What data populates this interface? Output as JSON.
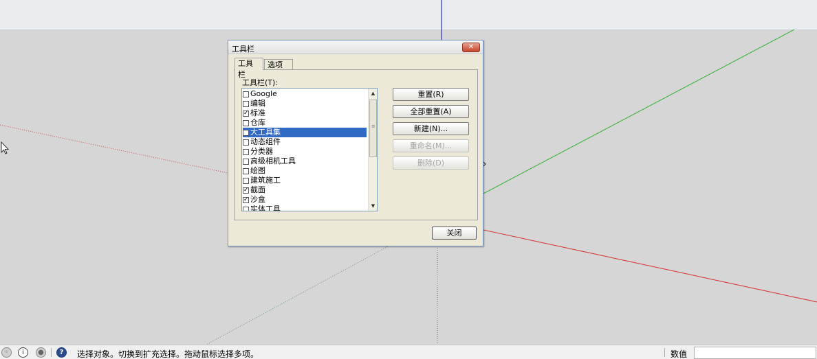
{
  "dialog": {
    "title": "工具栏",
    "close_symbol": "✕",
    "tabs": [
      {
        "label": "工具栏",
        "active": true
      },
      {
        "label": "选项",
        "active": false
      }
    ],
    "list_label": "工具栏(T):",
    "toolbars": [
      {
        "label": "Google",
        "checked": false
      },
      {
        "label": "编辑",
        "checked": false
      },
      {
        "label": "标准",
        "checked": true
      },
      {
        "label": "仓库",
        "checked": false
      },
      {
        "label": "大工具集",
        "checked": false,
        "selected": true
      },
      {
        "label": "动态组件",
        "checked": false
      },
      {
        "label": "分类器",
        "checked": false
      },
      {
        "label": "高级相机工具",
        "checked": false
      },
      {
        "label": "绘图",
        "checked": false
      },
      {
        "label": "建筑施工",
        "checked": false
      },
      {
        "label": "截面",
        "checked": true
      },
      {
        "label": "沙盒",
        "checked": true
      },
      {
        "label": "实体工具",
        "checked": false
      }
    ],
    "buttons": {
      "reset": "重置(R)",
      "reset_all": "全部重置(A)",
      "new": "新建(N)...",
      "rename": "重命名(M)...",
      "delete": "删除(D)"
    },
    "close_label": "关闭"
  },
  "statusbar": {
    "hint": "选择对象。切换到扩充选择。拖动鼠标选择多项。",
    "measure_label": "数值",
    "help_glyph": "?",
    "info_glyph": "i"
  },
  "colors": {
    "axis_red": "#d23c3c",
    "axis_green": "#3fb23f",
    "axis_blue": "#3a3acc",
    "selection": "#316ac5"
  }
}
